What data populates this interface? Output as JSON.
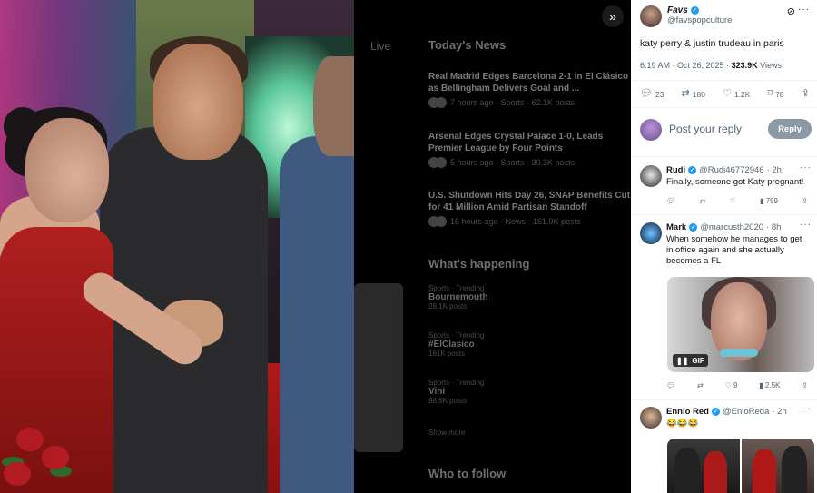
{
  "background": {
    "aside_title": "Today's News",
    "news": [
      {
        "headline": "Real Madrid Edges Barcelona 2-1 in El Clásico as Bellingham Delivers Goal and ...",
        "meta": "7 hours ago · Sports · 62.1K posts"
      },
      {
        "headline": "Arsenal Edges Crystal Palace 1-0, Leads Premier League by Four Points",
        "meta": "5 hours ago · Sports · 30.3K posts"
      },
      {
        "headline": "U.S. Shutdown Hits Day 26, SNAP Benefits Cut for 41 Million Amid Partisan Standoff",
        "meta": "16 hours ago · News · 161.9K posts"
      }
    ],
    "happening_title": "What's happening",
    "trends": [
      {
        "meta": "Sports · Trending",
        "name": "Bournemouth",
        "count": "28.1K posts"
      },
      {
        "meta": "Sports · Trending",
        "name": "#ElClasico",
        "count": "161K posts"
      },
      {
        "meta": "Sports · Trending",
        "name": "Vini",
        "count": "98.6K posts"
      }
    ],
    "show_more": "Show more",
    "who_to_follow": "Who to follow",
    "left_label": "Live"
  },
  "tweet": {
    "display_name": "Favs",
    "handle": "@favspopculture",
    "text": "katy perry & justin trudeau in paris",
    "time": "6:19 AM · Oct 26, 2025 ·",
    "views": "323.9K",
    "views_label": "Views",
    "replies": "23",
    "reposts": "180",
    "likes": "1.2K",
    "bookmarks": "78"
  },
  "compose": {
    "placeholder": "Post your reply",
    "button": "Reply"
  },
  "replies": [
    {
      "name": "Rudi",
      "handle": "@Rudi46772946",
      "age": "· 2h",
      "text": "Finally, someone got Katy pregnant!",
      "views": "759"
    },
    {
      "name": "Mark",
      "handle": "@marcusth2020",
      "age": "· 8h",
      "text": "When somehow he manages to get in office again and she actually becomes a FL",
      "likes": "9",
      "views": "2.5K",
      "gif_label": "GIF"
    },
    {
      "name": "Ennio Red",
      "handle": "@EnioReda",
      "age": "· 2h",
      "text": "😂😂😂"
    }
  ],
  "colors": {
    "accent": "#1d9bf0",
    "reply_button": "#8b98a5"
  }
}
